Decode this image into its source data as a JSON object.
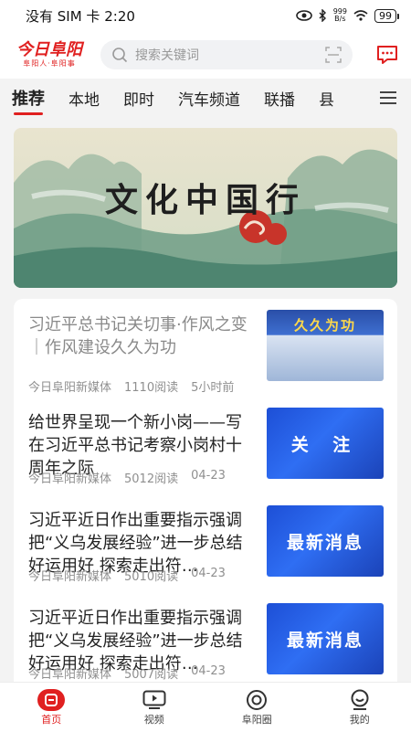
{
  "status": {
    "carrier": "没有 SIM 卡",
    "time": "2:20",
    "net_speed": "999\nB/s",
    "battery": "99"
  },
  "header": {
    "logo_main": "今日阜阳",
    "logo_sub": "阜阳人·阜阳事",
    "search_placeholder": "搜索关键词"
  },
  "tabs": [
    "推荐",
    "本地",
    "即时",
    "汽车频道",
    "联播",
    "县"
  ],
  "banner": {
    "title": "文化中国行"
  },
  "articles": [
    {
      "title": "习近平总书记关切事·作风之变｜作风建设久久为功",
      "source": "今日阜阳新媒体",
      "reads": "1110阅读",
      "time": "5小时前",
      "thumb_text": "久久为功",
      "read": true
    },
    {
      "title": "给世界呈现一个新小岗——写在习近平总书记考察小岗村十周年之际",
      "source": "今日阜阳新媒体",
      "reads": "5012阅读",
      "time": "04-23",
      "thumb_text": "关 注"
    },
    {
      "title": "习近平近日作出重要指示强调 把“义乌发展经验”进一步总结好运用好 探索走出符…",
      "source": "今日阜阳新媒体",
      "reads": "5010阅读",
      "time": "04-23",
      "thumb_text": "最新消息"
    },
    {
      "title": "习近平近日作出重要指示强调 把“义乌发展经验”进一步总结好运用好 探索走出符…",
      "source": "今日阜阳新媒体",
      "reads": "5007阅读",
      "time": "04-23",
      "thumb_text": "最新消息"
    }
  ],
  "bottom_nav": [
    {
      "label": "首页",
      "icon": "home-icon"
    },
    {
      "label": "视频",
      "icon": "video-icon"
    },
    {
      "label": "阜阳圈",
      "icon": "circle-icon"
    },
    {
      "label": "我的",
      "icon": "profile-icon"
    }
  ],
  "colors": {
    "brand": "#e02020",
    "thumb_blue": "#2f6ef3"
  }
}
